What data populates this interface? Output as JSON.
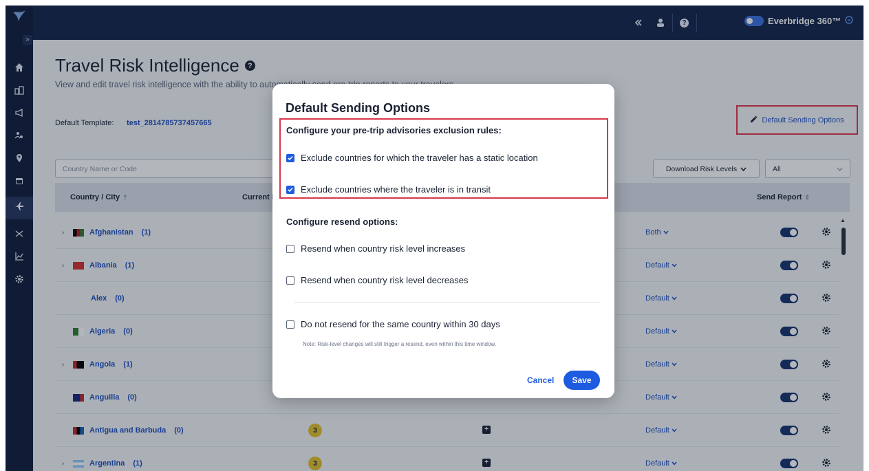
{
  "topbar": {
    "collapse_icon": "double-chevron-left-icon",
    "user_icon": "user-icon",
    "help_icon": "help-icon",
    "brand": "Everbridge 360™",
    "brand_toggle_icon": "toggle-icon",
    "brand_menu_icon": "circle-chevron-icon"
  },
  "sidebar": {
    "items": [
      {
        "icon": "home-icon"
      },
      {
        "icon": "buildings-icon"
      },
      {
        "icon": "megaphone-icon"
      },
      {
        "icon": "people-icon"
      },
      {
        "icon": "location-pin-icon"
      },
      {
        "icon": "calendar-icon"
      },
      {
        "icon": "airplane-icon",
        "active": true
      },
      {
        "icon": "crossed-arrows-icon"
      },
      {
        "icon": "chart-icon"
      },
      {
        "icon": "gear-icon"
      }
    ]
  },
  "page": {
    "title": "Travel Risk Intelligence",
    "subtitle": "View and edit travel risk intelligence with the ability to automatically send pre-trip reports to your travelers",
    "default_template_label": "Default Template:",
    "default_template_value": "test_2814785737457665",
    "default_sending_options_label": "Default Sending Options",
    "search_placeholder": "Country Name or Code",
    "download_risk_levels": "Download Risk Levels",
    "filter_value": "All"
  },
  "table": {
    "headers": {
      "country_city": "Country / City",
      "current_risk": "Current Ri",
      "send_report": "Send Report"
    },
    "rows": [
      {
        "expandable": true,
        "name": "Afghanistan",
        "count": "(1)",
        "flag": "af",
        "mode": "Both"
      },
      {
        "expandable": true,
        "name": "Albania",
        "count": "(1)",
        "flag": "al",
        "mode": "Default"
      },
      {
        "expandable": false,
        "indent": true,
        "name": "Alex",
        "count": "(0)",
        "flag": "",
        "mode": "Default"
      },
      {
        "expandable": false,
        "name": "Algeria",
        "count": "(0)",
        "flag": "dz",
        "mode": "Default"
      },
      {
        "expandable": true,
        "name": "Angola",
        "count": "(1)",
        "flag": "ao",
        "mode": "Default"
      },
      {
        "expandable": false,
        "name": "Anguilla",
        "count": "(0)",
        "flag": "ai",
        "mode": "Default"
      },
      {
        "expandable": false,
        "name": "Antigua and Barbuda",
        "count": "(0)",
        "flag": "ag",
        "mode": "Default",
        "risk": "3"
      },
      {
        "expandable": true,
        "name": "Argentina",
        "count": "(1)",
        "flag": "ar",
        "mode": "Default",
        "risk": "3"
      }
    ]
  },
  "modal": {
    "title": "Default Sending Options",
    "exclusion_heading": "Configure your pre-trip advisories exclusion rules:",
    "exclusion_options": [
      {
        "label": "Exclude countries for which the traveler has a static location",
        "checked": true
      },
      {
        "label": "Exclude countries where the traveler is in transit",
        "checked": true
      }
    ],
    "resend_heading": "Configure resend options:",
    "resend_options": [
      {
        "label": "Resend when country risk level increases",
        "checked": false
      },
      {
        "label": "Resend when country risk level decreases",
        "checked": false
      }
    ],
    "no_resend_option": {
      "label": "Do not resend for the same country within 30 days",
      "checked": false
    },
    "note": "Note: Risk-level changes will still trigger a resend, even within this time window.",
    "cancel_label": "Cancel",
    "save_label": "Save"
  }
}
